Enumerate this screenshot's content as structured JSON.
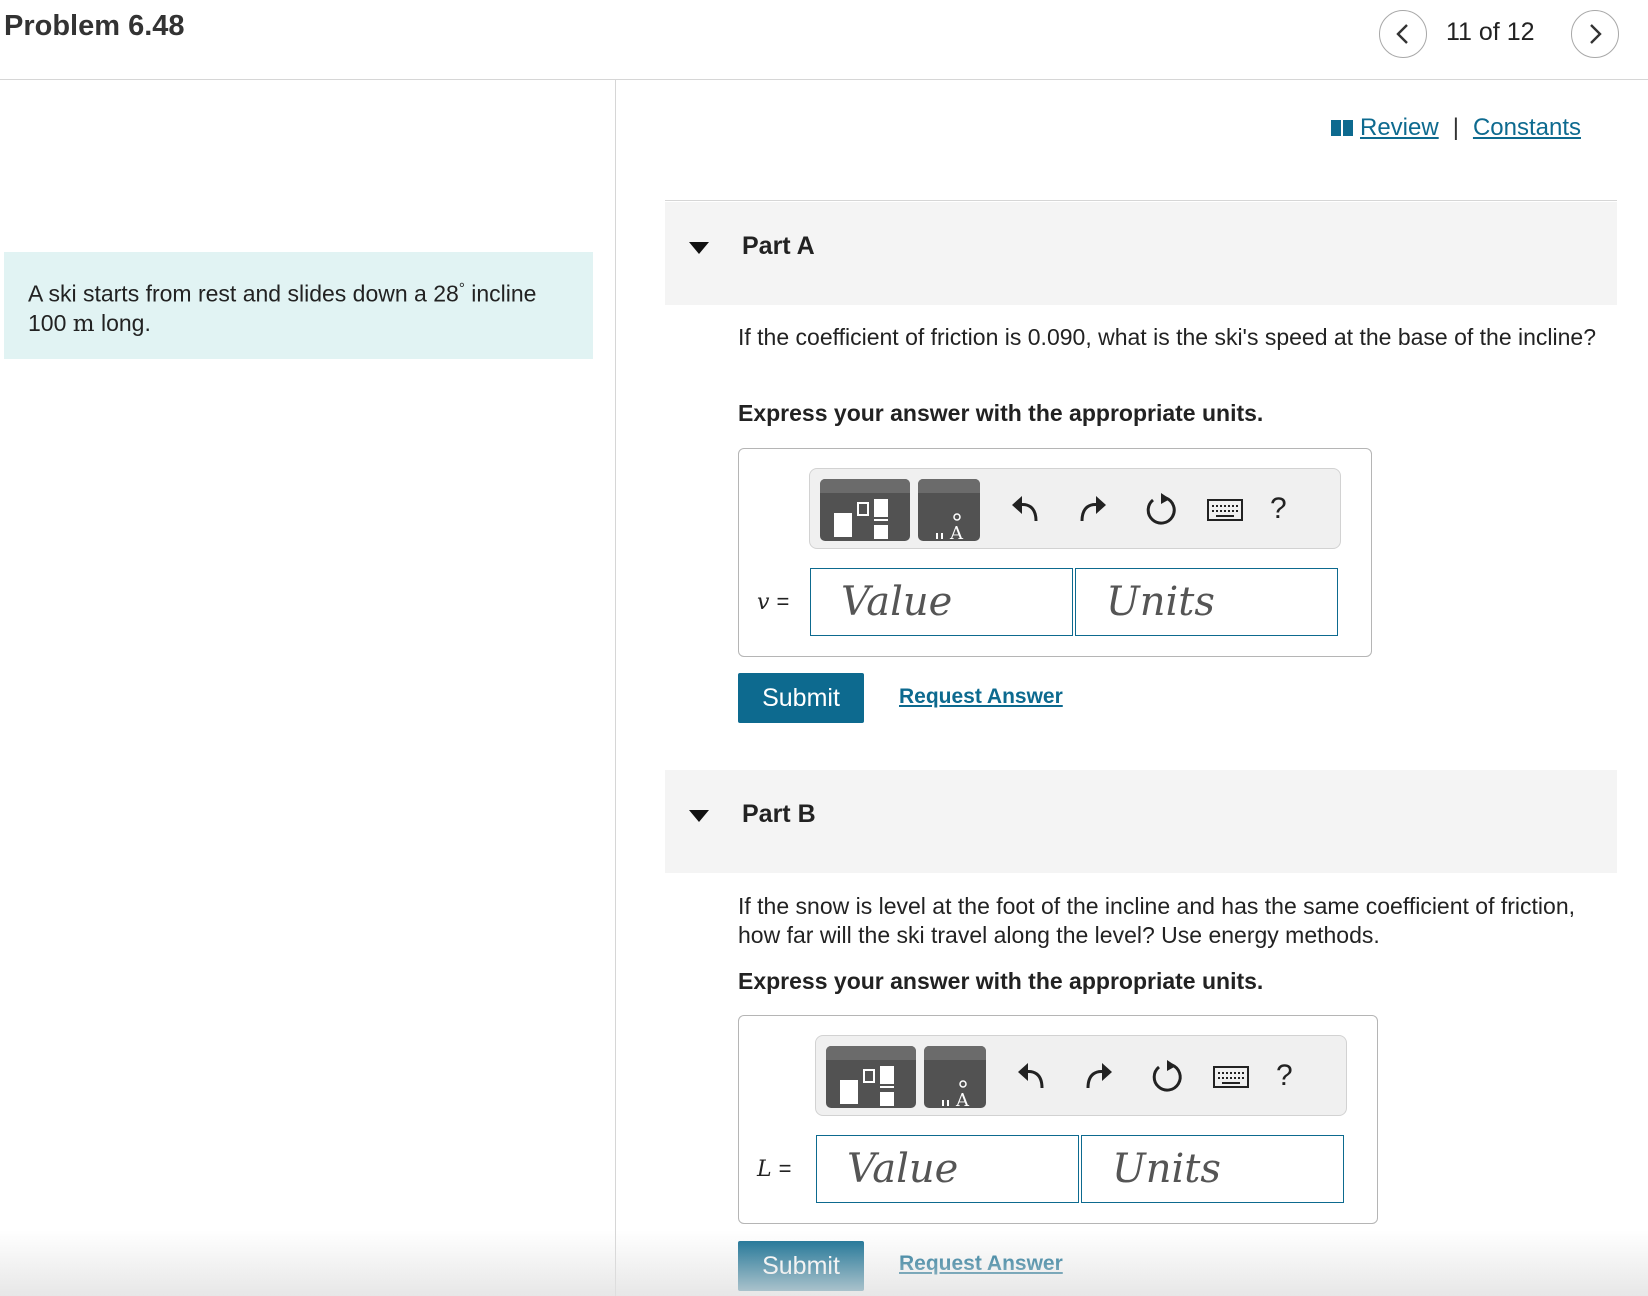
{
  "header": {
    "title": "Problem 6.48",
    "counter": "11 of 12",
    "prev_icon": "chevron-left-icon",
    "next_icon": "chevron-right-icon"
  },
  "intro": {
    "text_before": "A ski starts from rest and slides down a 28",
    "degree": "°",
    "text_middle": " incline",
    "length_value": "100 ",
    "length_unit": "m",
    "text_end": " long."
  },
  "links": {
    "review": "Review",
    "separator": "|",
    "constants": "Constants",
    "book_icon": "book-icon"
  },
  "parts": [
    {
      "label": "Part A",
      "question": "If the coefficient of friction is 0.090, what is the ski's speed at the base of the incline?",
      "instruction": "Express your answer with the appropriate units.",
      "variable": "v",
      "equals": "=",
      "value_placeholder": "Value",
      "units_placeholder": "Units",
      "submit_label": "Submit",
      "request_label": "Request Answer",
      "help_label": "?"
    },
    {
      "label": "Part B",
      "question": "If the snow is level at the foot of the incline and has the same coefficient of friction, how far will the ski travel along the level? Use energy methods.",
      "instruction": "Express your answer with the appropriate units.",
      "variable": "L",
      "equals": "=",
      "value_placeholder": "Value",
      "units_placeholder": "Units",
      "submit_label": "Submit",
      "request_label": "Request Answer",
      "help_label": "?"
    }
  ],
  "colors": {
    "accent": "#0d6a8f",
    "intro_bg": "#e1f3f3",
    "part_header_bg": "#f4f4f4"
  }
}
